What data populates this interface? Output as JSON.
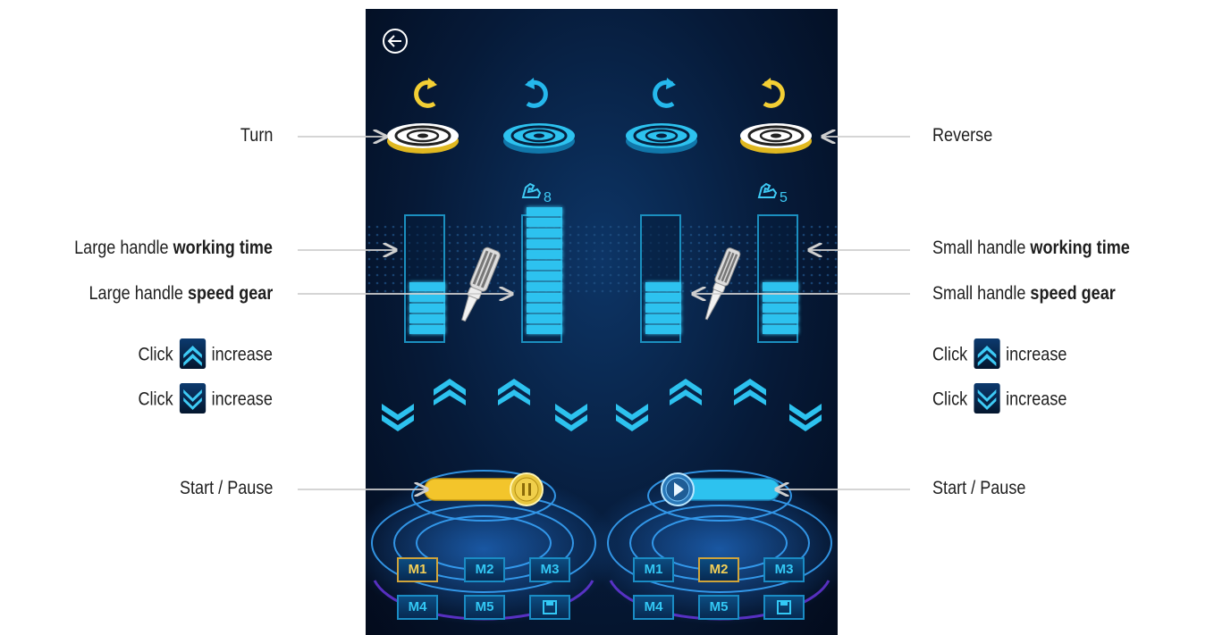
{
  "labels": {
    "turn": "Turn",
    "reverse": "Reverse",
    "large_working_prefix": "Large handle",
    "large_working_bold": "working time",
    "large_speed_prefix": "Large handle",
    "large_speed_bold": "speed gear",
    "small_working_prefix": "Small handle",
    "small_working_bold": "working time",
    "small_speed_prefix": "Small handle",
    "small_speed_bold": "speed gear",
    "click": "Click",
    "increase": "increase",
    "start_pause": "Start / Pause"
  },
  "panel": {
    "left_handle": {
      "gear_level": "8",
      "working_time_bars": 5,
      "speed_gear_bars": 12,
      "toggle_state": "running",
      "selected_mode": "M1"
    },
    "right_handle": {
      "gear_level": "5",
      "working_time_bars": 5,
      "speed_gear_bars": 5,
      "toggle_state": "paused",
      "selected_mode": "M2"
    },
    "mode_buttons_row1": [
      "M1",
      "M2",
      "M3"
    ],
    "mode_buttons_row2": [
      "M4",
      "M5"
    ],
    "colors": {
      "accent_blue": "#2dc2ef",
      "accent_yellow": "#f3cf34",
      "background": "#061a38"
    }
  }
}
